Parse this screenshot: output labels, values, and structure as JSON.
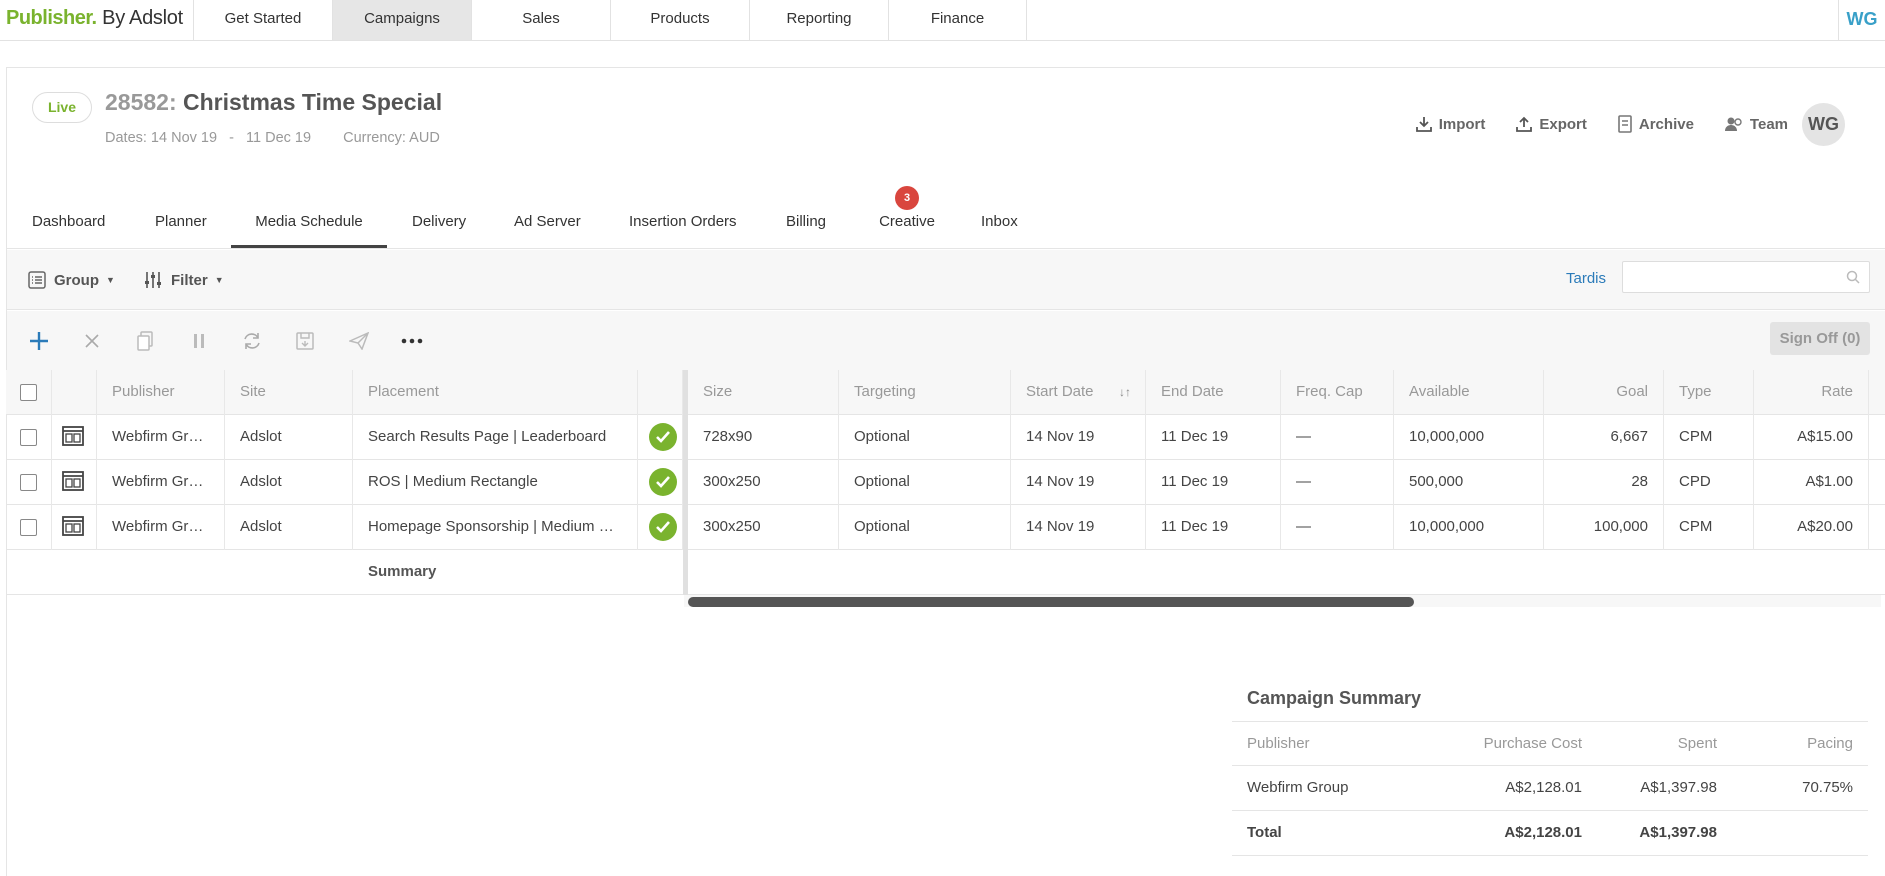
{
  "app": {
    "logo_main": "Publisher.",
    "logo_sub": "By Adslot",
    "user_initials": "WG"
  },
  "topnav": [
    "Get Started",
    "Campaigns",
    "Sales",
    "Products",
    "Reporting",
    "Finance"
  ],
  "campaign": {
    "status": "Live",
    "id": "28582:",
    "name": "Christmas Time Special",
    "dates": "Dates: 14 Nov 19   -   11 Dec 19",
    "currency": "Currency: AUD"
  },
  "actions": {
    "import": "Import",
    "export": "Export",
    "archive": "Archive",
    "team": "Team",
    "avatar": "WG"
  },
  "subtabs": [
    "Dashboard",
    "Planner",
    "Media Schedule",
    "Delivery",
    "Ad Server",
    "Insertion Orders",
    "Billing",
    "Creative",
    "Inbox"
  ],
  "creative_badge": "3",
  "toolbar": {
    "group": "Group",
    "filter": "Filter",
    "tardis": "Tardis",
    "search_placeholder": "",
    "signoff": "Sign Off (0)"
  },
  "grid": {
    "columns": [
      "Publisher",
      "Site",
      "Placement",
      "Size",
      "Targeting",
      "Start Date",
      "End Date",
      "Freq. Cap",
      "Available",
      "Goal",
      "Type",
      "Rate"
    ],
    "rows": [
      {
        "publisher": "Webfirm Group",
        "site": "Adslot",
        "placement": "Search Results Page | Leaderboard",
        "size": "728x90",
        "targeting": "Optional",
        "start": "14 Nov 19",
        "end": "11 Dec 19",
        "freq": "—",
        "available": "10,000,000",
        "goal": "6,667",
        "type": "CPM",
        "rate": "A$15.00"
      },
      {
        "publisher": "Webfirm Group",
        "site": "Adslot",
        "placement": "ROS | Medium Rectangle",
        "size": "300x250",
        "targeting": "Optional",
        "start": "14 Nov 19",
        "end": "11 Dec 19",
        "freq": "—",
        "available": "500,000",
        "goal": "28",
        "type": "CPD",
        "rate": "A$1.00"
      },
      {
        "publisher": "Webfirm Group",
        "site": "Adslot",
        "placement": "Homepage Sponsorship | Medium Rectangle",
        "size": "300x250",
        "targeting": "Optional",
        "start": "14 Nov 19",
        "end": "11 Dec 19",
        "freq": "—",
        "available": "10,000,000",
        "goal": "100,000",
        "type": "CPM",
        "rate": "A$20.00"
      }
    ],
    "summary_label": "Summary"
  },
  "campaign_summary": {
    "title": "Campaign Summary",
    "columns": [
      "Publisher",
      "Purchase Cost",
      "Spent",
      "Pacing"
    ],
    "rows": [
      {
        "publisher": "Webfirm Group",
        "cost": "A$2,128.01",
        "spent": "A$1,397.98",
        "pacing": "70.75%"
      }
    ],
    "total": {
      "label": "Total",
      "cost": "A$2,128.01",
      "spent": "A$1,397.98"
    }
  }
}
